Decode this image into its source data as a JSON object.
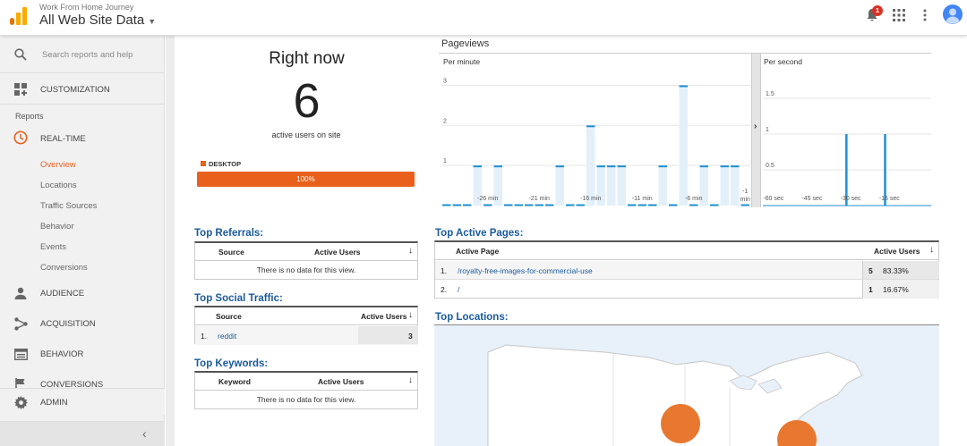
{
  "header": {
    "account": "Work From Home Journey",
    "property": "All Web Site Data",
    "notification_count": "1"
  },
  "sidebar": {
    "search_placeholder": "Search reports and help",
    "customization": "CUSTOMIZATION",
    "reports_heading": "Reports",
    "realtime": "REAL-TIME",
    "realtime_items": [
      "Overview",
      "Locations",
      "Traffic Sources",
      "Behavior",
      "Events",
      "Conversions"
    ],
    "audience": "AUDIENCE",
    "acquisition": "ACQUISITION",
    "behavior": "BEHAVIOR",
    "conversions": "CONVERSIONS",
    "admin": "ADMIN",
    "collapse_icon": "chevron-left-icon"
  },
  "right_now": {
    "title": "Right now",
    "count": "6",
    "subtitle": "active users on site",
    "device_label": "DESKTOP",
    "device_percent": "100%",
    "device_fraction": 1.0
  },
  "pageviews": {
    "title": "Pageviews",
    "per_minute_label": "Per minute",
    "per_second_label": "Per second",
    "minute_y_ticks": [
      "3",
      "2",
      "1"
    ],
    "minute_x_ticks": [
      "-26 min",
      "-21 min",
      "-16 min",
      "-11 min",
      "-6 min",
      "-1 min"
    ],
    "second_y_ticks": [
      "1.5",
      "1",
      "0.5"
    ],
    "second_x_ticks": [
      "-60 sec",
      "-45 sec",
      "-30 sec",
      "-15 sec"
    ]
  },
  "chart_data": [
    {
      "type": "bar",
      "title": "Per minute",
      "x": [
        -30,
        -29,
        -28,
        -27,
        -26,
        -25,
        -24,
        -23,
        -22,
        -21,
        -20,
        -19,
        -18,
        -17,
        -16,
        -15,
        -14,
        -13,
        -12,
        -11,
        -10,
        -9,
        -8,
        -7,
        -6,
        -5,
        -4,
        -3,
        -2,
        -1
      ],
      "values": [
        0,
        0,
        0,
        1,
        0,
        1,
        0,
        0,
        0,
        0,
        0,
        1,
        0,
        0,
        2,
        1,
        1,
        1,
        0,
        0,
        0,
        1,
        0,
        3,
        0,
        1,
        0,
        1,
        1,
        0
      ],
      "ylim": [
        0,
        3.3
      ],
      "grid": true
    },
    {
      "type": "bar",
      "title": "Per second",
      "x": [
        -60,
        -55,
        -50,
        -45,
        -40,
        -35,
        -30,
        -25,
        -20,
        -15,
        -10,
        -5
      ],
      "values": [
        0,
        0,
        0,
        0,
        0,
        0,
        1,
        0,
        0,
        1,
        0,
        0
      ],
      "ylim": [
        0,
        1.85
      ],
      "grid": true
    }
  ],
  "top_referrals": {
    "title": "Top Referrals:",
    "col_source": "Source",
    "col_users": "Active Users",
    "empty": "There is no data for this view."
  },
  "top_social": {
    "title": "Top Social Traffic:",
    "col_source": "Source",
    "col_users": "Active Users",
    "rows": [
      {
        "idx": "1.",
        "source": "reddit",
        "users": "3"
      }
    ]
  },
  "top_keywords": {
    "title": "Top Keywords:",
    "col_keyword": "Keyword",
    "col_users": "Active Users",
    "empty": "There is no data for this view."
  },
  "top_pages": {
    "title": "Top Active Pages:",
    "col_page": "Active Page",
    "col_users": "Active Users",
    "rows": [
      {
        "idx": "1.",
        "page": "/royalty-free-images-for-commercial-use",
        "users": "5",
        "pct": "83.33%",
        "fraction": 0.8333
      },
      {
        "idx": "2.",
        "page": "/",
        "users": "1",
        "pct": "16.67%",
        "fraction": 0.1667
      }
    ]
  },
  "top_locations": {
    "title": "Top Locations:"
  },
  "colors": {
    "accent": "#e8601c",
    "link": "#1a5b9c",
    "bar": "#1f8fd0"
  }
}
